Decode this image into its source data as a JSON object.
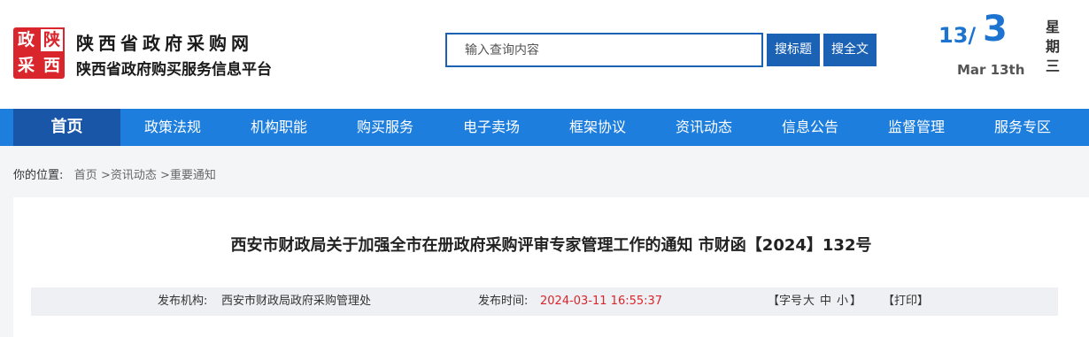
{
  "header": {
    "logo_chars": [
      "政",
      "陕",
      "采",
      "西"
    ],
    "site_name": "陕西省政府采购网",
    "site_subtitle": "陕西省政府购买服务信息平台",
    "search_placeholder": "输入查询内容",
    "search_title_button": "搜标题",
    "search_full_button": "搜全文",
    "date_day": "13",
    "date_sep": "/",
    "date_month": "3",
    "date_en": "Mar 13th",
    "weekday_chars": [
      "星",
      "期",
      "三"
    ]
  },
  "nav": {
    "items": [
      "首页",
      "政策法规",
      "机构职能",
      "购买服务",
      "电子卖场",
      "框架协议",
      "资讯动态",
      "信息公告",
      "监督管理",
      "服务专区"
    ]
  },
  "breadcrumb": {
    "label": "你的位置:",
    "home": "首页",
    "sep": ">",
    "level1": "资讯动态",
    "level2": "重要通知"
  },
  "article": {
    "title": "西安市财政局关于加强全市在册政府采购评审专家管理工作的通知 市财函【2024】132号",
    "org_label": "发布机构:",
    "org_value": "西安市财政局政府采购管理处",
    "time_label": "发布时间:",
    "time_value": "2024-03-11 16:55:37",
    "size_open": "【字号",
    "size_big": "大",
    "size_mid": "中",
    "size_small": "小",
    "size_close": "】",
    "print_label": "【打印】"
  },
  "colors": {
    "brand_blue": "#1d7ede",
    "nav_active": "#1a56a8",
    "button_blue": "#1b62b5",
    "date_blue": "#1d73d0",
    "logo_red": "#d9262c",
    "time_red": "#d9262c"
  }
}
